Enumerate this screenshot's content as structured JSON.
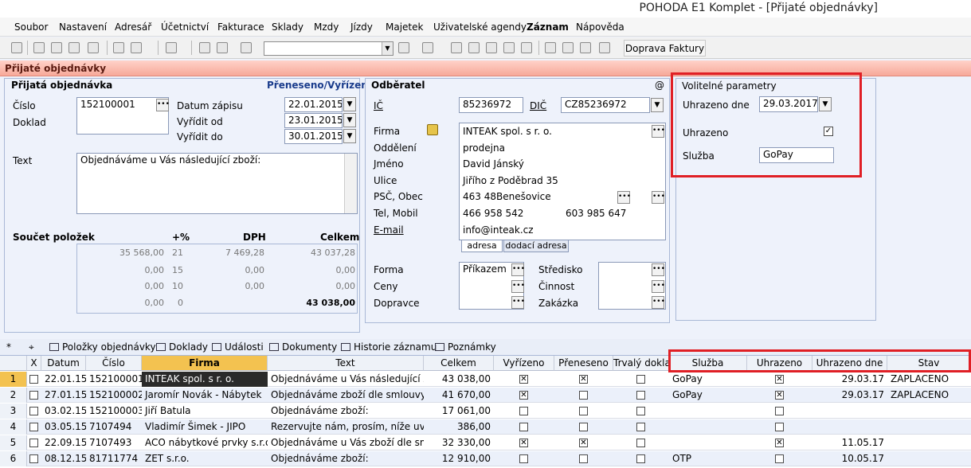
{
  "title": "POHODA E1 Komplet - [Přijaté objednávky]",
  "menu": [
    "Soubor",
    "Nastavení",
    "Adresář",
    "Účetnictví",
    "Fakturace",
    "Sklady",
    "Mzdy",
    "Jízdy",
    "Majetek",
    "Uživatelské agendy",
    "Záznam",
    "Nápověda"
  ],
  "toolbar": {
    "doprava_label": "Doprava Faktury",
    "combo_value": ""
  },
  "module_title": "Přijaté objednávky",
  "order": {
    "section": "Přijatá objednávka",
    "status": "Přeneseno/Vyřízeno",
    "cislo_label": "Číslo",
    "cislo": "152100001",
    "doklad_label": "Doklad",
    "datum_zapisu_label": "Datum zápisu",
    "datum_zapisu": "22.01.2015",
    "vyridit_od_label": "Vyřídit od",
    "vyridit_od": "23.01.2015",
    "vyridit_do_label": "Vyřídit do",
    "vyridit_do": "30.01.2015",
    "text_label": "Text",
    "text": "Objednáváme u Vás následující zboží:"
  },
  "summary": {
    "label": "Součet položek",
    "pct_label": "+%",
    "dph_label": "DPH",
    "celkem_label": "Celkem",
    "rows": [
      [
        "35 568,00",
        "21",
        "7 469,28",
        "43 037,28"
      ],
      [
        "0,00",
        "15",
        "0,00",
        "0,00"
      ],
      [
        "0,00",
        "10",
        "0,00",
        "0,00"
      ],
      [
        "0,00",
        "0",
        "",
        "43 038,00"
      ]
    ]
  },
  "customer": {
    "section": "Odběratel",
    "at": "@",
    "ic_label": "IČ",
    "ic": "85236972",
    "dic_label": "DIČ",
    "dic": "CZ85236972",
    "firma_label": "Firma",
    "firma": "INTEAK spol. s r. o.",
    "oddeleni_label": "Oddělení",
    "oddeleni": "prodejna",
    "jmeno_label": "Jméno",
    "jmeno": "David Jánský",
    "ulice_label": "Ulice",
    "ulice": "Jiřího z Poděbrad 35",
    "psc_label": "PSČ, Obec",
    "psc": "463 48",
    "obec": "Benešovice",
    "tel_label": "Tel, Mobil",
    "tel": "466 958 542",
    "mobil": "603 985 647",
    "email_label": "E-mail",
    "email": "info@inteak.cz",
    "tab_adresa": "adresa",
    "tab_dodaci": "dodací adresa",
    "forma_label": "Forma",
    "forma": "Příkazem",
    "ceny_label": "Ceny",
    "dopravce_label": "Dopravce",
    "stredisko_label": "Středisko",
    "cinnost_label": "Činnost",
    "zakazka_label": "Zakázka"
  },
  "optional": {
    "section": "Volitelné parametry",
    "uhrazeno_dne_label": "Uhrazeno dne",
    "uhrazeno_dne": "29.03.2017",
    "uhrazeno_label": "Uhrazeno",
    "sluzba_label": "Služba",
    "sluzba": "GoPay"
  },
  "tabs": [
    "*",
    "",
    "Položky objednávky",
    "Doklady",
    "Události",
    "Dokumenty",
    "Historie záznamu",
    "Poznámky"
  ],
  "grid": {
    "columns": [
      "X",
      "Datum",
      "Číslo",
      "Firma",
      "Text",
      "Celkem",
      "Vyřízeno",
      "Přeneseno",
      "Trvalý dokla",
      "Služba",
      "Uhrazeno",
      "Uhrazeno dne",
      "Stav"
    ],
    "rows": [
      {
        "n": "1",
        "datum": "22.01.15",
        "cislo": "152100001",
        "firma": "INTEAK spol. s r. o.",
        "text": "Objednáváme u Vás následující zb",
        "celkem": "43 038,00",
        "vyrizeno": true,
        "preneseno": true,
        "trvaly": false,
        "sluzba": "GoPay",
        "uhrazeno": true,
        "uhrazeno_dne": "29.03.17",
        "stav": "ZAPLACENO"
      },
      {
        "n": "2",
        "datum": "27.01.15",
        "cislo": "152100002",
        "firma": "Jaromír Novák - Nábytek",
        "text": "Objednáváme zboží dle smlouvy č.",
        "celkem": "41 670,00",
        "vyrizeno": true,
        "preneseno": false,
        "trvaly": false,
        "sluzba": "GoPay",
        "uhrazeno": true,
        "uhrazeno_dne": "29.03.17",
        "stav": "ZAPLACENO"
      },
      {
        "n": "3",
        "datum": "03.02.15",
        "cislo": "152100003",
        "firma": "Jiří Batula",
        "text": "Objednáváme zboží:",
        "celkem": "17 061,00",
        "vyrizeno": false,
        "preneseno": false,
        "trvaly": false,
        "sluzba": "",
        "uhrazeno": false,
        "uhrazeno_dne": "",
        "stav": ""
      },
      {
        "n": "4",
        "datum": "03.05.15",
        "cislo": "7107494",
        "firma": "Vladimír Šimek - JIPO",
        "text": "Rezervujte nám, prosím, níže uved",
        "celkem": "386,00",
        "vyrizeno": false,
        "preneseno": false,
        "trvaly": false,
        "sluzba": "",
        "uhrazeno": false,
        "uhrazeno_dne": "",
        "stav": ""
      },
      {
        "n": "5",
        "datum": "22.09.15",
        "cislo": "7107493",
        "firma": "ACO nábytkové prvky s.r.o.",
        "text": "Objednáváme u Vás zboží dle smlo",
        "celkem": "32 330,00",
        "vyrizeno": true,
        "preneseno": true,
        "trvaly": false,
        "sluzba": "",
        "uhrazeno": true,
        "uhrazeno_dne": "11.05.17",
        "stav": ""
      },
      {
        "n": "6",
        "datum": "08.12.15",
        "cislo": "81711774",
        "firma": "ZET s.r.o.",
        "text": "Objednáváme zboží:",
        "celkem": "12 910,00",
        "vyrizeno": false,
        "preneseno": false,
        "trvaly": false,
        "sluzba": "OTP",
        "uhrazeno": false,
        "uhrazeno_dne": "10.05.17",
        "stav": ""
      }
    ]
  }
}
